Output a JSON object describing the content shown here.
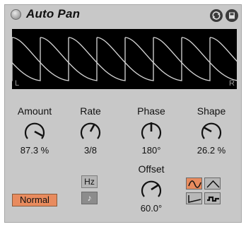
{
  "title": "Auto Pan",
  "display": {
    "left_label": "L",
    "right_label": "R"
  },
  "knobs": {
    "amount": {
      "label": "Amount",
      "value": "87.3 %"
    },
    "rate": {
      "label": "Rate",
      "value": "3/8"
    },
    "phase": {
      "label": "Phase",
      "value": "180°"
    },
    "shape": {
      "label": "Shape",
      "value": "26.2 %"
    },
    "offset": {
      "label": "Offset",
      "value": "60.0°"
    }
  },
  "buttons": {
    "hz_label": "Hz",
    "note_label": "♪",
    "normal_label": "Normal"
  },
  "icons": {
    "power": "power-icon",
    "hot_swap": "hot-swap-icon",
    "save": "save-icon"
  },
  "colors": {
    "panel": "#c8c8c8",
    "accent_orange": "#e88b5e",
    "display_bg": "#000000",
    "waveform": "#d8d8d8"
  }
}
